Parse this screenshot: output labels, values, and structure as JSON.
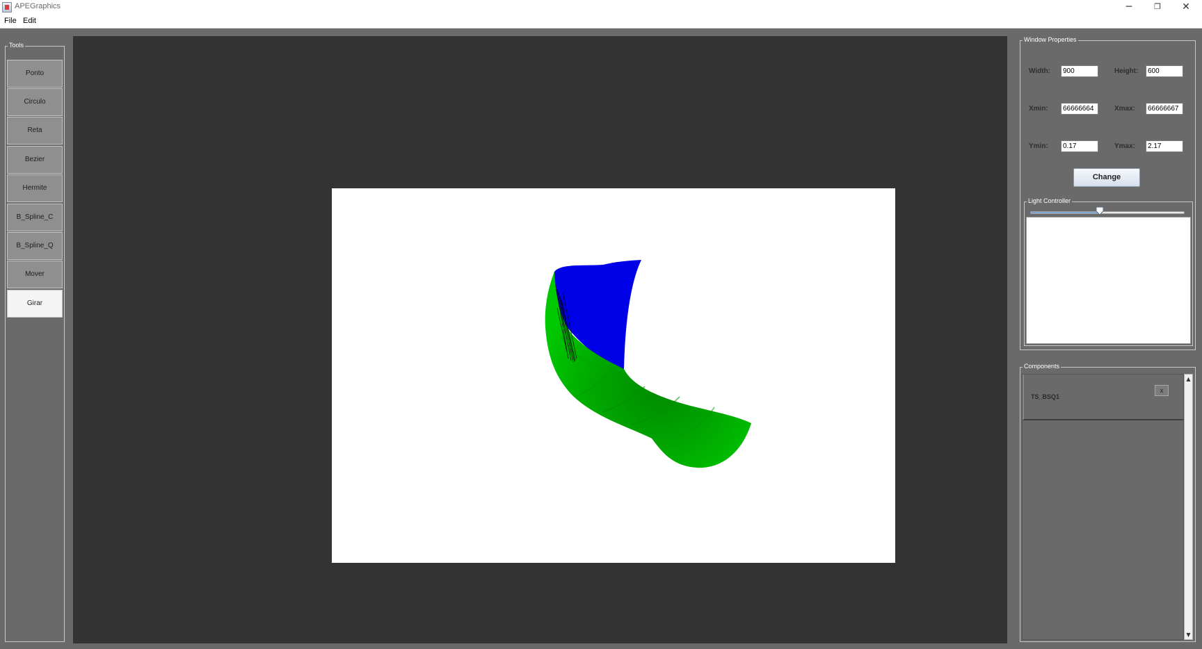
{
  "titlebar": {
    "title": "APEGraphics",
    "minimize": "─",
    "restore": "❐",
    "close": "✕"
  },
  "menu": {
    "items": [
      "File",
      "Edit"
    ]
  },
  "tools": {
    "title": "Tools",
    "buttons": [
      "Ponto",
      "Circulo",
      "Reta",
      "Bezier",
      "Hermite",
      "B_Spline_C",
      "B_Spline_Q",
      "Mover",
      "Girar"
    ],
    "selected": "Girar"
  },
  "window_properties": {
    "title": "Window Properties",
    "width_label": "Width:",
    "width_value": "900",
    "height_label": "Height:",
    "height_value": "600",
    "xmin_label": "Xmin:",
    "xmin_value": "66666664",
    "xmax_label": "Xmax:",
    "xmax_value": "66666667",
    "ymin_label": "Ymin:",
    "ymin_value": "0.17",
    "ymax_label": "Ymax:",
    "ymax_value": "2.17",
    "change_label": "Change"
  },
  "light_controller": {
    "title": "Light Controller",
    "slider_fraction": 0.45
  },
  "components": {
    "title": "Components",
    "items": [
      {
        "name": "TS_BSQ1",
        "delete_label": "x"
      }
    ]
  },
  "colors": {
    "surface_blue": "#0000e6",
    "surface_green": "#00b800",
    "canvas_bg": "#333333",
    "panel_bg": "#6a6a6a"
  }
}
